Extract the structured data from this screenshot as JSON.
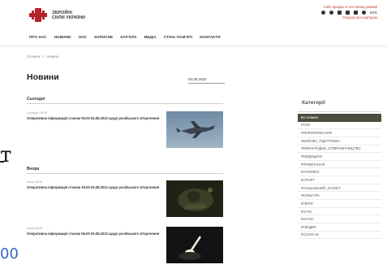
{
  "brand": {
    "line1": "ЗБРОЙНІ",
    "line2": "СИЛИ УКРАЇНИ",
    "color": "#b4232a"
  },
  "header_right": {
    "link_top": "Сайт працює в тестовому режимі",
    "link_bottom": "Пошуки про кар'єрою",
    "lang": "ENG",
    "social_icons": [
      "facebook-icon",
      "twitter-icon",
      "youtube-icon",
      "instagram-icon",
      "telegram-icon",
      "flickr-icon"
    ]
  },
  "nav": {
    "items": [
      "ПРО НАС",
      "НОВИНИ",
      "ООС",
      "КОРИСНЕ",
      "КАР'ЄРА",
      "МЕДІА",
      "СТІНА ПАМ'ЯТІ",
      "КОНТАКТИ"
    ]
  },
  "breadcrumb": {
    "home": "Головна",
    "separator": ">",
    "current": "Новини"
  },
  "page": {
    "title": "Новини",
    "date_value": "04.08.2022"
  },
  "sections": [
    {
      "heading": "Сьогодні",
      "items": [
        {
          "meta": "Сьогодні / 08:38",
          "title": "Оперативна інформація станом 06.00 04.08.2022 щодо російського вторгнення"
        }
      ]
    },
    {
      "heading": "Вчора",
      "items": [
        {
          "meta": "Вчора 18:08",
          "title": "Оперативна інформація станом 18.00 03.08.2022 щодо російського вторгнення"
        },
        {
          "meta": "Вчора 06:08",
          "title": "Оперативна інформація станом 06.00 03.08.2022 щодо російського вторгнення"
        }
      ]
    }
  ],
  "sidebar": {
    "heading": "Категорії",
    "items": [
      "Всі новини",
      "#ООС",
      "#РЕФОРМУВАННЯ",
      "#БОЙОВА_ПІДГОТОВКА",
      "#МІЖНАРОДНЕ_СПІВРОБІТНИЦТВО",
      "#МЕДИЦИНА",
      "#ПРИВІТАННЯ",
      "#ІНТЕРВ'Ю",
      "#СПОРТ",
      "#СОЦІАЛЬНИЙ_ЗАХИСТ",
      "#КУЛЬТУРА",
      "#ГЕРОЇ",
      "#НАТО",
      "#НАУКА",
      "#ГЕНДЕР",
      "#COVID-19"
    ],
    "active_index": 0,
    "active_color": "#4a4d3f"
  },
  "overlay_artifacts": {
    "glyph": "т",
    "text": "00"
  }
}
